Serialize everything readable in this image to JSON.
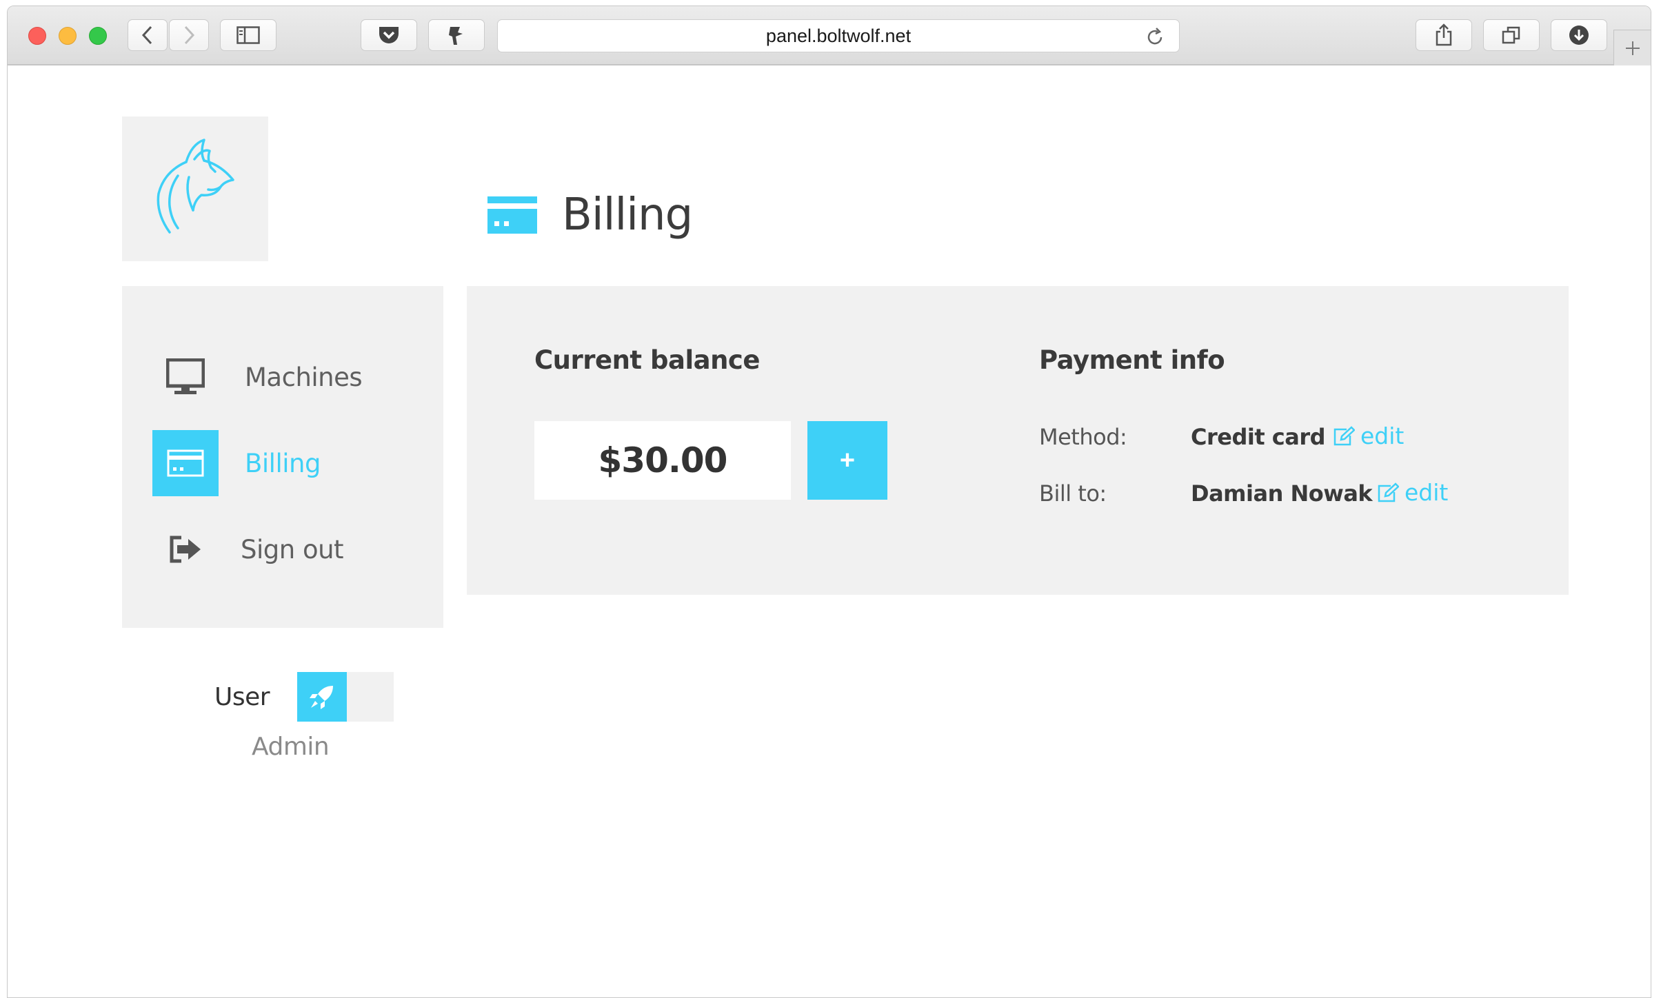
{
  "browser": {
    "url": "panel.boltwolf.net"
  },
  "header": {
    "title": "Billing"
  },
  "sidebar": {
    "items": [
      {
        "label": "Machines",
        "icon": "monitor-icon",
        "active": false
      },
      {
        "label": "Billing",
        "icon": "credit-card-icon",
        "active": true
      },
      {
        "label": "Sign out",
        "icon": "sign-out-icon",
        "active": false
      }
    ]
  },
  "roles": {
    "user_label": "User",
    "admin_label": "Admin",
    "toggle_icon": "rocket-icon"
  },
  "balance": {
    "title": "Current balance",
    "amount": "$30.00",
    "add_label": "+"
  },
  "payment": {
    "title": "Payment info",
    "method_label": "Method:",
    "method_value": "Credit card",
    "bill_to_label": "Bill to:",
    "bill_to_value": "Damian Nowak",
    "edit_label": "edit"
  },
  "colors": {
    "accent": "#3ed0f7",
    "panel": "#f1f1f1",
    "text": "#3a3a3a"
  }
}
